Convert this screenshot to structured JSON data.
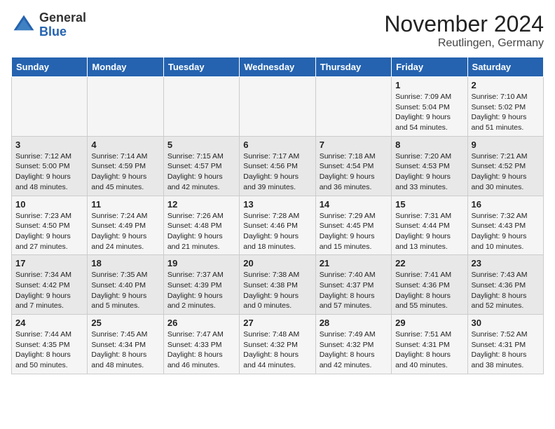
{
  "header": {
    "logo_general": "General",
    "logo_blue": "Blue",
    "title": "November 2024",
    "subtitle": "Reutlingen, Germany"
  },
  "days_of_week": [
    "Sunday",
    "Monday",
    "Tuesday",
    "Wednesday",
    "Thursday",
    "Friday",
    "Saturday"
  ],
  "weeks": [
    [
      {
        "day": "",
        "info": ""
      },
      {
        "day": "",
        "info": ""
      },
      {
        "day": "",
        "info": ""
      },
      {
        "day": "",
        "info": ""
      },
      {
        "day": "",
        "info": ""
      },
      {
        "day": "1",
        "info": "Sunrise: 7:09 AM\nSunset: 5:04 PM\nDaylight: 9 hours and 54 minutes."
      },
      {
        "day": "2",
        "info": "Sunrise: 7:10 AM\nSunset: 5:02 PM\nDaylight: 9 hours and 51 minutes."
      }
    ],
    [
      {
        "day": "3",
        "info": "Sunrise: 7:12 AM\nSunset: 5:00 PM\nDaylight: 9 hours and 48 minutes."
      },
      {
        "day": "4",
        "info": "Sunrise: 7:14 AM\nSunset: 4:59 PM\nDaylight: 9 hours and 45 minutes."
      },
      {
        "day": "5",
        "info": "Sunrise: 7:15 AM\nSunset: 4:57 PM\nDaylight: 9 hours and 42 minutes."
      },
      {
        "day": "6",
        "info": "Sunrise: 7:17 AM\nSunset: 4:56 PM\nDaylight: 9 hours and 39 minutes."
      },
      {
        "day": "7",
        "info": "Sunrise: 7:18 AM\nSunset: 4:54 PM\nDaylight: 9 hours and 36 minutes."
      },
      {
        "day": "8",
        "info": "Sunrise: 7:20 AM\nSunset: 4:53 PM\nDaylight: 9 hours and 33 minutes."
      },
      {
        "day": "9",
        "info": "Sunrise: 7:21 AM\nSunset: 4:52 PM\nDaylight: 9 hours and 30 minutes."
      }
    ],
    [
      {
        "day": "10",
        "info": "Sunrise: 7:23 AM\nSunset: 4:50 PM\nDaylight: 9 hours and 27 minutes."
      },
      {
        "day": "11",
        "info": "Sunrise: 7:24 AM\nSunset: 4:49 PM\nDaylight: 9 hours and 24 minutes."
      },
      {
        "day": "12",
        "info": "Sunrise: 7:26 AM\nSunset: 4:48 PM\nDaylight: 9 hours and 21 minutes."
      },
      {
        "day": "13",
        "info": "Sunrise: 7:28 AM\nSunset: 4:46 PM\nDaylight: 9 hours and 18 minutes."
      },
      {
        "day": "14",
        "info": "Sunrise: 7:29 AM\nSunset: 4:45 PM\nDaylight: 9 hours and 15 minutes."
      },
      {
        "day": "15",
        "info": "Sunrise: 7:31 AM\nSunset: 4:44 PM\nDaylight: 9 hours and 13 minutes."
      },
      {
        "day": "16",
        "info": "Sunrise: 7:32 AM\nSunset: 4:43 PM\nDaylight: 9 hours and 10 minutes."
      }
    ],
    [
      {
        "day": "17",
        "info": "Sunrise: 7:34 AM\nSunset: 4:42 PM\nDaylight: 9 hours and 7 minutes."
      },
      {
        "day": "18",
        "info": "Sunrise: 7:35 AM\nSunset: 4:40 PM\nDaylight: 9 hours and 5 minutes."
      },
      {
        "day": "19",
        "info": "Sunrise: 7:37 AM\nSunset: 4:39 PM\nDaylight: 9 hours and 2 minutes."
      },
      {
        "day": "20",
        "info": "Sunrise: 7:38 AM\nSunset: 4:38 PM\nDaylight: 9 hours and 0 minutes."
      },
      {
        "day": "21",
        "info": "Sunrise: 7:40 AM\nSunset: 4:37 PM\nDaylight: 8 hours and 57 minutes."
      },
      {
        "day": "22",
        "info": "Sunrise: 7:41 AM\nSunset: 4:36 PM\nDaylight: 8 hours and 55 minutes."
      },
      {
        "day": "23",
        "info": "Sunrise: 7:43 AM\nSunset: 4:36 PM\nDaylight: 8 hours and 52 minutes."
      }
    ],
    [
      {
        "day": "24",
        "info": "Sunrise: 7:44 AM\nSunset: 4:35 PM\nDaylight: 8 hours and 50 minutes."
      },
      {
        "day": "25",
        "info": "Sunrise: 7:45 AM\nSunset: 4:34 PM\nDaylight: 8 hours and 48 minutes."
      },
      {
        "day": "26",
        "info": "Sunrise: 7:47 AM\nSunset: 4:33 PM\nDaylight: 8 hours and 46 minutes."
      },
      {
        "day": "27",
        "info": "Sunrise: 7:48 AM\nSunset: 4:32 PM\nDaylight: 8 hours and 44 minutes."
      },
      {
        "day": "28",
        "info": "Sunrise: 7:49 AM\nSunset: 4:32 PM\nDaylight: 8 hours and 42 minutes."
      },
      {
        "day": "29",
        "info": "Sunrise: 7:51 AM\nSunset: 4:31 PM\nDaylight: 8 hours and 40 minutes."
      },
      {
        "day": "30",
        "info": "Sunrise: 7:52 AM\nSunset: 4:31 PM\nDaylight: 8 hours and 38 minutes."
      }
    ]
  ]
}
